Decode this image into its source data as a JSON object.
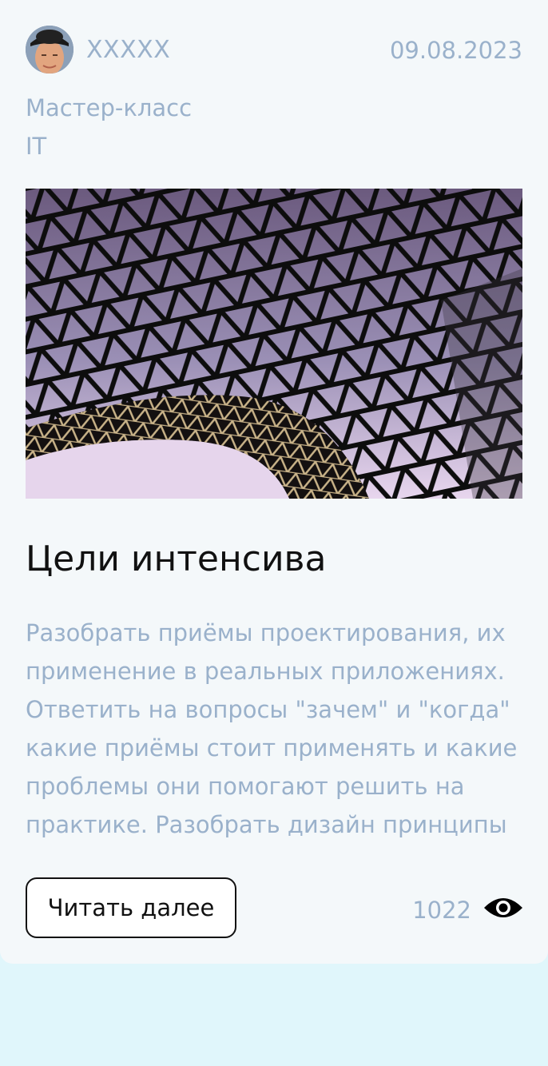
{
  "post": {
    "author": "XXXXX",
    "date": "09.08.2023",
    "type": "Мастер-класс",
    "topic": "IT",
    "title": "Цели интенсива",
    "text": "Разобрать приёмы проектирования, их применение в реальных приложениях. Ответить на вопросы \"зачем\" и \"когда\" какие приёмы стоит применять и какие проблемы они помогают решить на практике. Разобрать дизайн принципы",
    "read_more_label": "Читать далее",
    "views": "1022",
    "views_icon": "eye-icon",
    "avatar_icon": "avatar"
  },
  "colors": {
    "page_background": "#e0f6fb",
    "card_background": "#f4f8fa",
    "muted_text": "#9ab1cb",
    "primary_text": "#111111"
  }
}
